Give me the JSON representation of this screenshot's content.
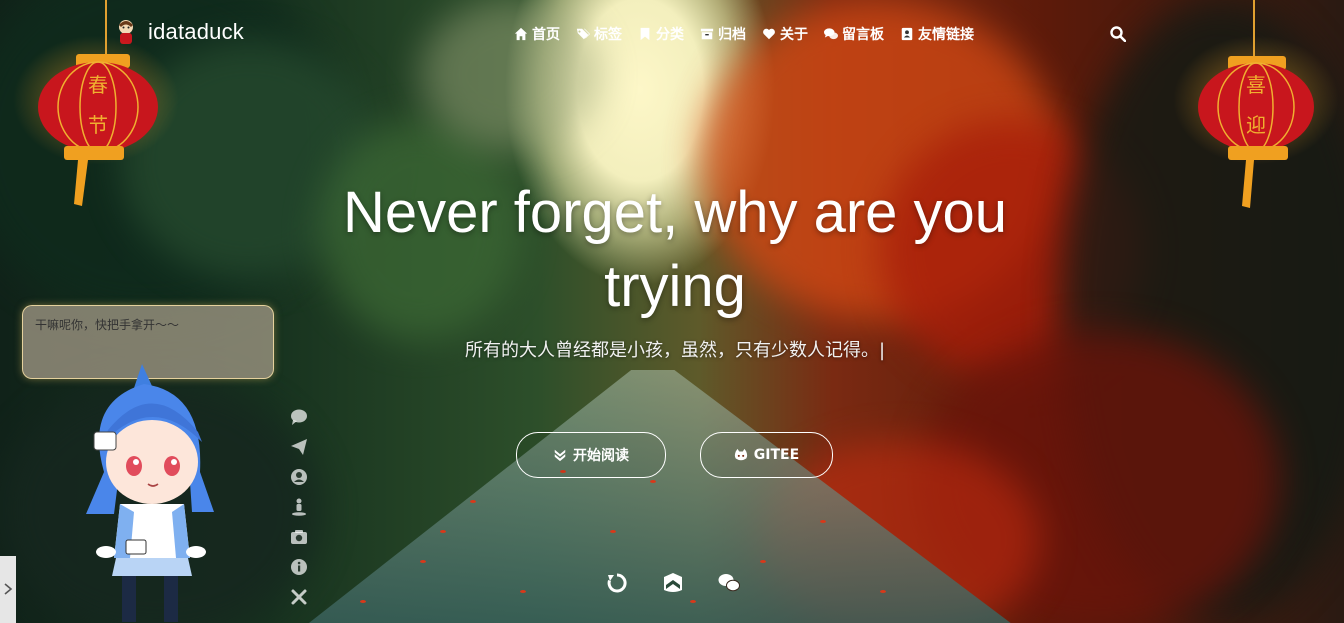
{
  "brand": {
    "name": "idataduck",
    "logo_icon": "duck-mascot-icon"
  },
  "nav": {
    "items": [
      {
        "label": "首页",
        "icon": "home-icon"
      },
      {
        "label": "标签",
        "icon": "tags-icon"
      },
      {
        "label": "分类",
        "icon": "bookmark-icon"
      },
      {
        "label": "归档",
        "icon": "archive-icon"
      },
      {
        "label": "关于",
        "icon": "heart-icon"
      },
      {
        "label": "留言板",
        "icon": "comments-icon"
      },
      {
        "label": "友情链接",
        "icon": "address-book-icon"
      }
    ],
    "search_icon": "search-icon"
  },
  "hero": {
    "title": "Never forget, why are you trying",
    "subtitle": "所有的大人曾经都是小孩，虽然，只有少数人记得。|",
    "buttons": {
      "read": "开始阅读",
      "gitee": "GITEE"
    }
  },
  "social": [
    "refresh-icon",
    "shield-icon",
    "wechat-icon"
  ],
  "lanterns": {
    "left": [
      "春",
      "节"
    ],
    "right": [
      "喜",
      "迎"
    ]
  },
  "live2d": {
    "message": "干嘛呢你，快把手拿开～～",
    "tools": [
      "comment-icon",
      "paper-plane-icon",
      "user-circle-icon",
      "street-view-icon",
      "camera-icon",
      "info-circle-icon",
      "close-icon"
    ]
  },
  "colors": {
    "lantern_red": "#c8161d",
    "lantern_gold": "#f0a020",
    "accent_white": "#ffffff"
  }
}
